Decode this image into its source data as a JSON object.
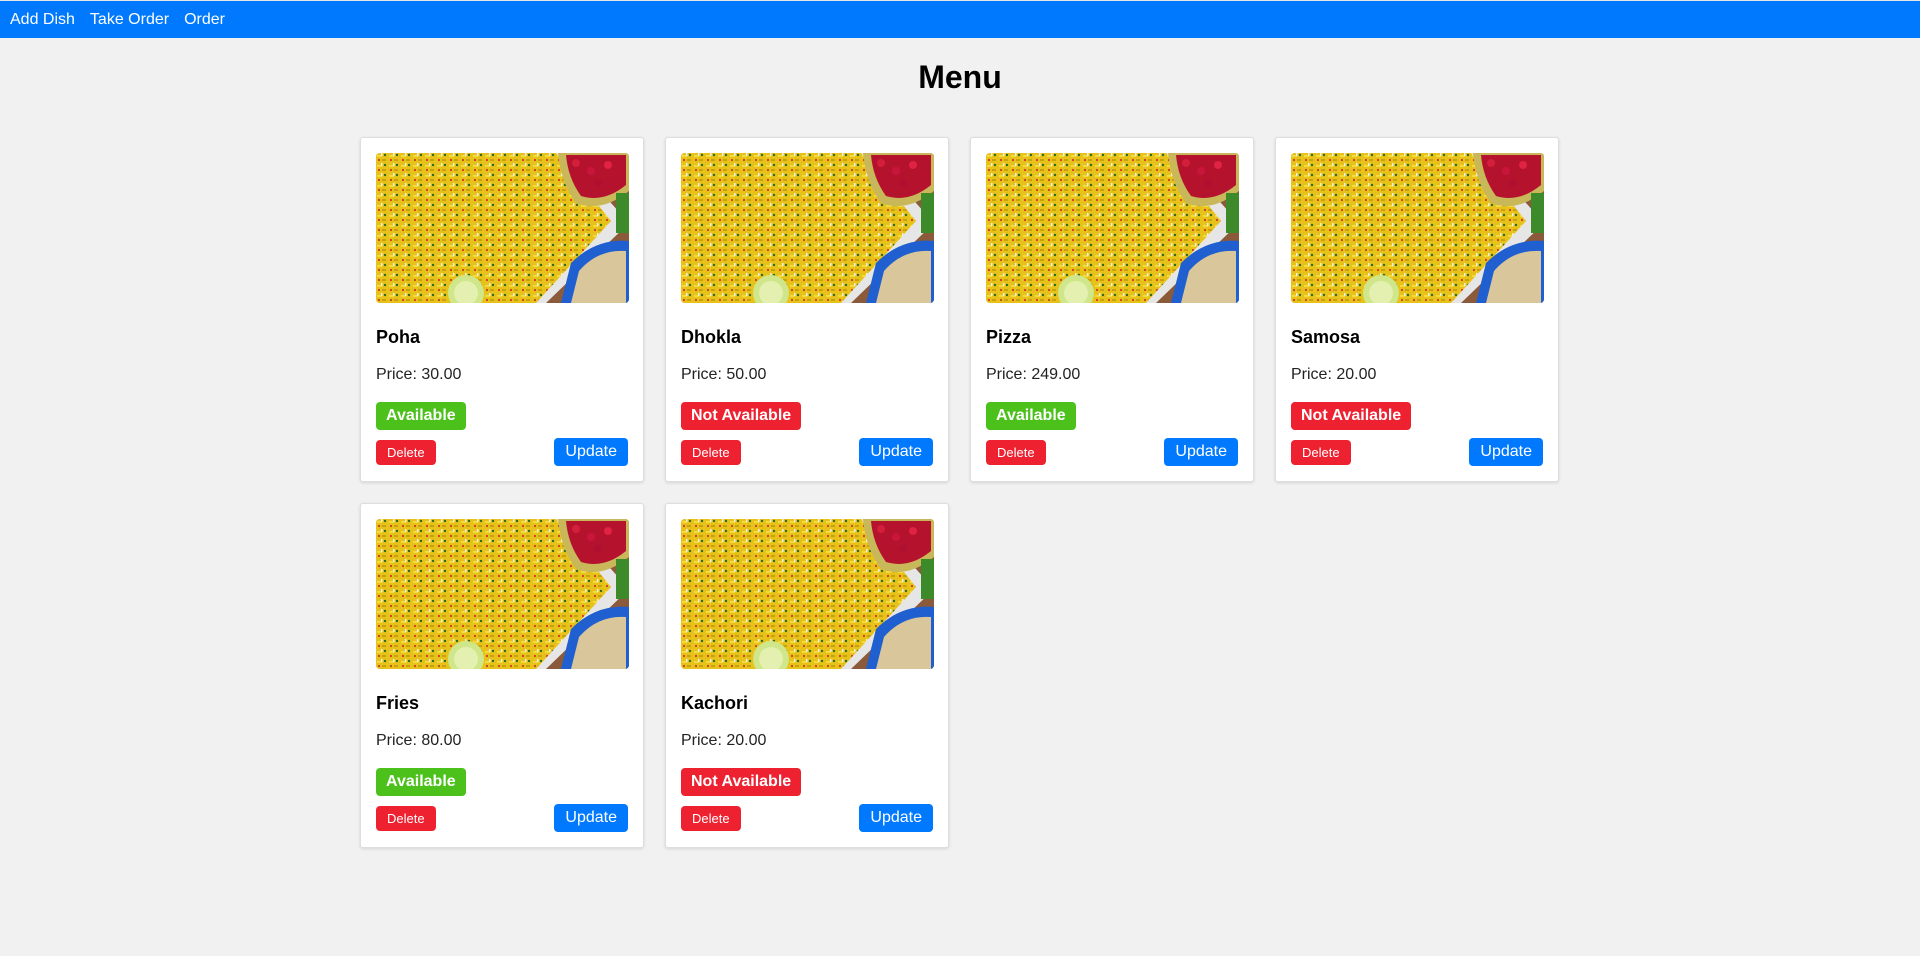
{
  "nav": {
    "items": [
      "Add Dish",
      "Take Order",
      "Order"
    ]
  },
  "page": {
    "title": "Menu"
  },
  "price_prefix": "Price: ",
  "buttons": {
    "delete": "Delete",
    "update": "Update"
  },
  "status_labels": {
    "available": "Available",
    "unavailable": "Not Available"
  },
  "colors": {
    "brand": "#0079fe",
    "available": "#4cc11c",
    "unavailable": "#ee2130",
    "background": "#f1f1f1"
  },
  "dishes": [
    {
      "name": "Poha",
      "price": "30.00",
      "available": true
    },
    {
      "name": "Dhokla",
      "price": "50.00",
      "available": false
    },
    {
      "name": "Pizza",
      "price": "249.00",
      "available": true
    },
    {
      "name": "Samosa",
      "price": "20.00",
      "available": false
    },
    {
      "name": "Fries",
      "price": "80.00",
      "available": true
    },
    {
      "name": "Kachori",
      "price": "20.00",
      "available": false
    }
  ]
}
